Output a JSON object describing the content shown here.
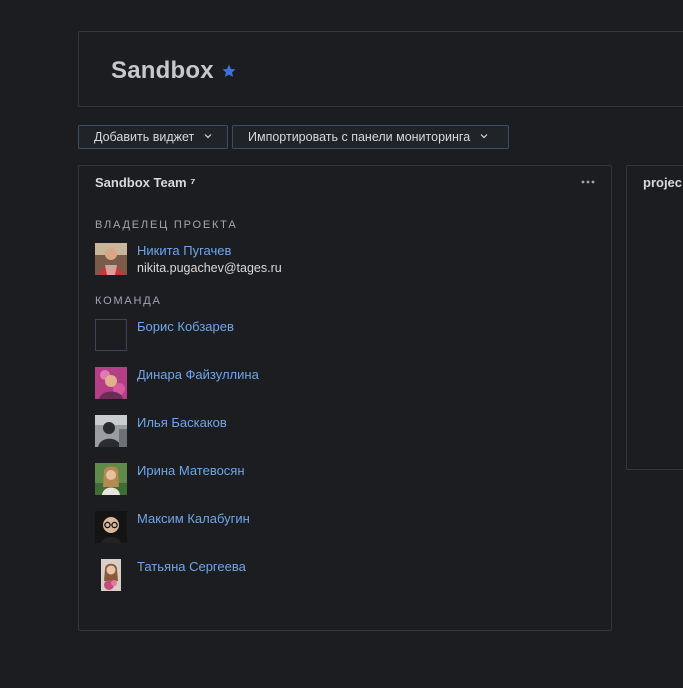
{
  "dashboard": {
    "title": "Sandbox",
    "starred_icon": "star-icon",
    "accent_color": "#3d71d9"
  },
  "toolbar": {
    "add_widget_label": "Добавить виджет",
    "import_label": "Импортировать с панели мониторинга"
  },
  "team_panel": {
    "title": "Sandbox Team ⁷",
    "menu_icon": "more-horizontal-icon",
    "owner_section_label": "ВЛАДЕЛЕЦ ПРОЕКТА",
    "owner": {
      "name": "Никита Пугачев",
      "email": "nikita.pugachev@tages.ru"
    },
    "team_section_label": "КОМАНДА",
    "members": [
      {
        "name": "Борис Кобзарев"
      },
      {
        "name": "Динара Файзуллина"
      },
      {
        "name": "Илья Баскаков"
      },
      {
        "name": "Ирина Матевосян"
      },
      {
        "name": "Максим Калабугин"
      },
      {
        "name": "Татьяна Сергеева"
      }
    ]
  },
  "project_panel": {
    "title": "projec"
  },
  "colors": {
    "background": "#1c1d21",
    "panel_border": "#34363b",
    "link": "#6ea6eb",
    "section_label": "#9fa7b3"
  }
}
